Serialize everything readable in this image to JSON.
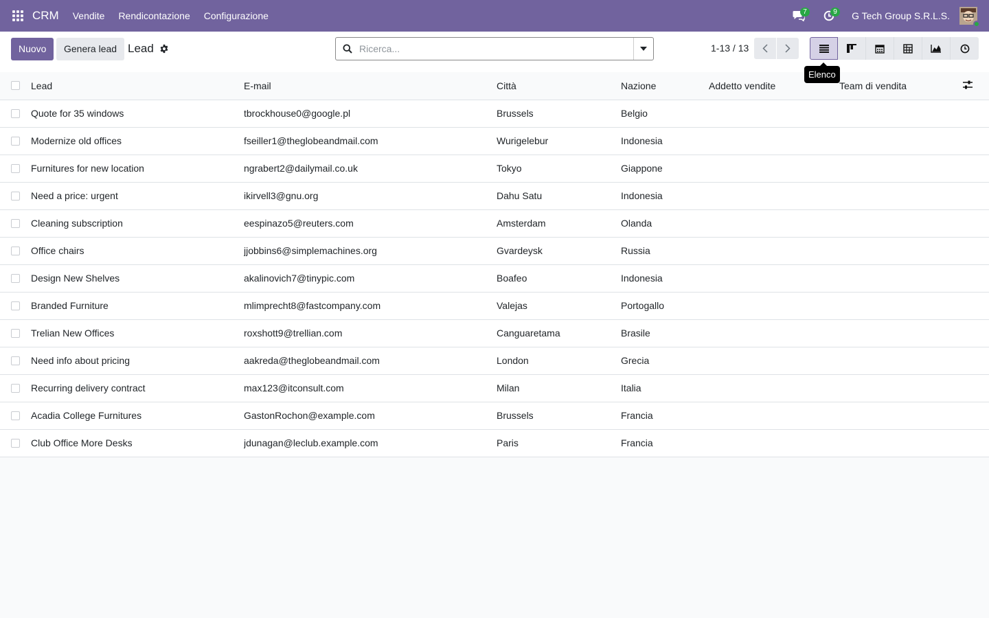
{
  "navbar": {
    "brand": "CRM",
    "menu": [
      "Vendite",
      "Rendicontazione",
      "Configurazione"
    ],
    "messages_count": "7",
    "activities_count": "9",
    "company": "G Tech Group S.R.L.S."
  },
  "control": {
    "new_label": "Nuovo",
    "generate_label": "Genera lead",
    "breadcrumb": "Lead",
    "search_placeholder": "Ricerca...",
    "pager": "1-13 / 13",
    "active_view_tooltip": "Elenco"
  },
  "table": {
    "headers": {
      "lead": "Lead",
      "email": "E-mail",
      "city": "Città",
      "country": "Nazione",
      "salesperson": "Addetto vendite",
      "team": "Team di vendita"
    },
    "rows": [
      {
        "lead": "Quote for 35 windows",
        "email": "tbrockhouse0@google.pl",
        "city": "Brussels",
        "country": "Belgio"
      },
      {
        "lead": "Modernize old offices",
        "email": "fseiller1@theglobeandmail.com",
        "city": "Wurigelebur",
        "country": "Indonesia"
      },
      {
        "lead": "Furnitures for new location",
        "email": "ngrabert2@dailymail.co.uk",
        "city": "Tokyo",
        "country": "Giappone"
      },
      {
        "lead": "Need a price: urgent",
        "email": "ikirvell3@gnu.org",
        "city": "Dahu Satu",
        "country": "Indonesia"
      },
      {
        "lead": "Cleaning subscription",
        "email": "eespinazo5@reuters.com",
        "city": "Amsterdam",
        "country": "Olanda"
      },
      {
        "lead": "Office chairs",
        "email": "jjobbins6@simplemachines.org",
        "city": "Gvardeysk",
        "country": "Russia"
      },
      {
        "lead": "Design New Shelves",
        "email": "akalinovich7@tinypic.com",
        "city": "Boafeo",
        "country": "Indonesia"
      },
      {
        "lead": "Branded Furniture",
        "email": "mlimprecht8@fastcompany.com",
        "city": "Valejas",
        "country": "Portogallo"
      },
      {
        "lead": "Trelian New Offices",
        "email": "roxshott9@trellian.com",
        "city": "Canguaretama",
        "country": "Brasile"
      },
      {
        "lead": "Need info about pricing",
        "email": "aakreda@theglobeandmail.com",
        "city": "London",
        "country": "Grecia"
      },
      {
        "lead": "Recurring delivery contract",
        "email": "max123@itconsult.com",
        "city": "Milan",
        "country": "Italia"
      },
      {
        "lead": "Acadia College Furnitures",
        "email": "GastonRochon@example.com",
        "city": "Brussels",
        "country": "Francia"
      },
      {
        "lead": "Club Office More Desks",
        "email": "jdunagan@leclub.example.com",
        "city": "Paris",
        "country": "Francia"
      }
    ]
  },
  "colors": {
    "brand": "#71639e",
    "badge": "#28a745"
  }
}
